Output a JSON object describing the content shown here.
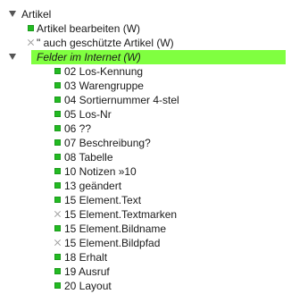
{
  "colors": {
    "active_mark": "#22bb22",
    "highlight": "#80ff40"
  },
  "root": {
    "label": "Artikel"
  },
  "artikel_children": [
    {
      "label": "Artikel bearbeiten (W)",
      "active": true
    },
    {
      "label": "\" auch geschützte Artikel (W)",
      "active": false
    }
  ],
  "group": {
    "label": "Felder im Internet (W)"
  },
  "fields": [
    {
      "label": "02 Los-Kennung",
      "active": true
    },
    {
      "label": "03 Warengruppe",
      "active": true
    },
    {
      "label": "04 Sortiernummer 4-stel",
      "active": true
    },
    {
      "label": "05 Los-Nr",
      "active": true
    },
    {
      "label": "06 ??",
      "active": true
    },
    {
      "label": "07 Beschreibung?",
      "active": true
    },
    {
      "label": "08 Tabelle",
      "active": true
    },
    {
      "label": "10 Notizen »10",
      "active": true
    },
    {
      "label": "13 geändert",
      "active": true
    },
    {
      "label": "15 Element.Text",
      "active": true
    },
    {
      "label": "15 Element.Textmarken",
      "active": false
    },
    {
      "label": "15 Element.Bildname",
      "active": true
    },
    {
      "label": "15 Element.Bildpfad",
      "active": false
    },
    {
      "label": "18 Erhalt",
      "active": true
    },
    {
      "label": "19 Ausruf",
      "active": true
    },
    {
      "label": "20 Layout",
      "active": true
    }
  ]
}
